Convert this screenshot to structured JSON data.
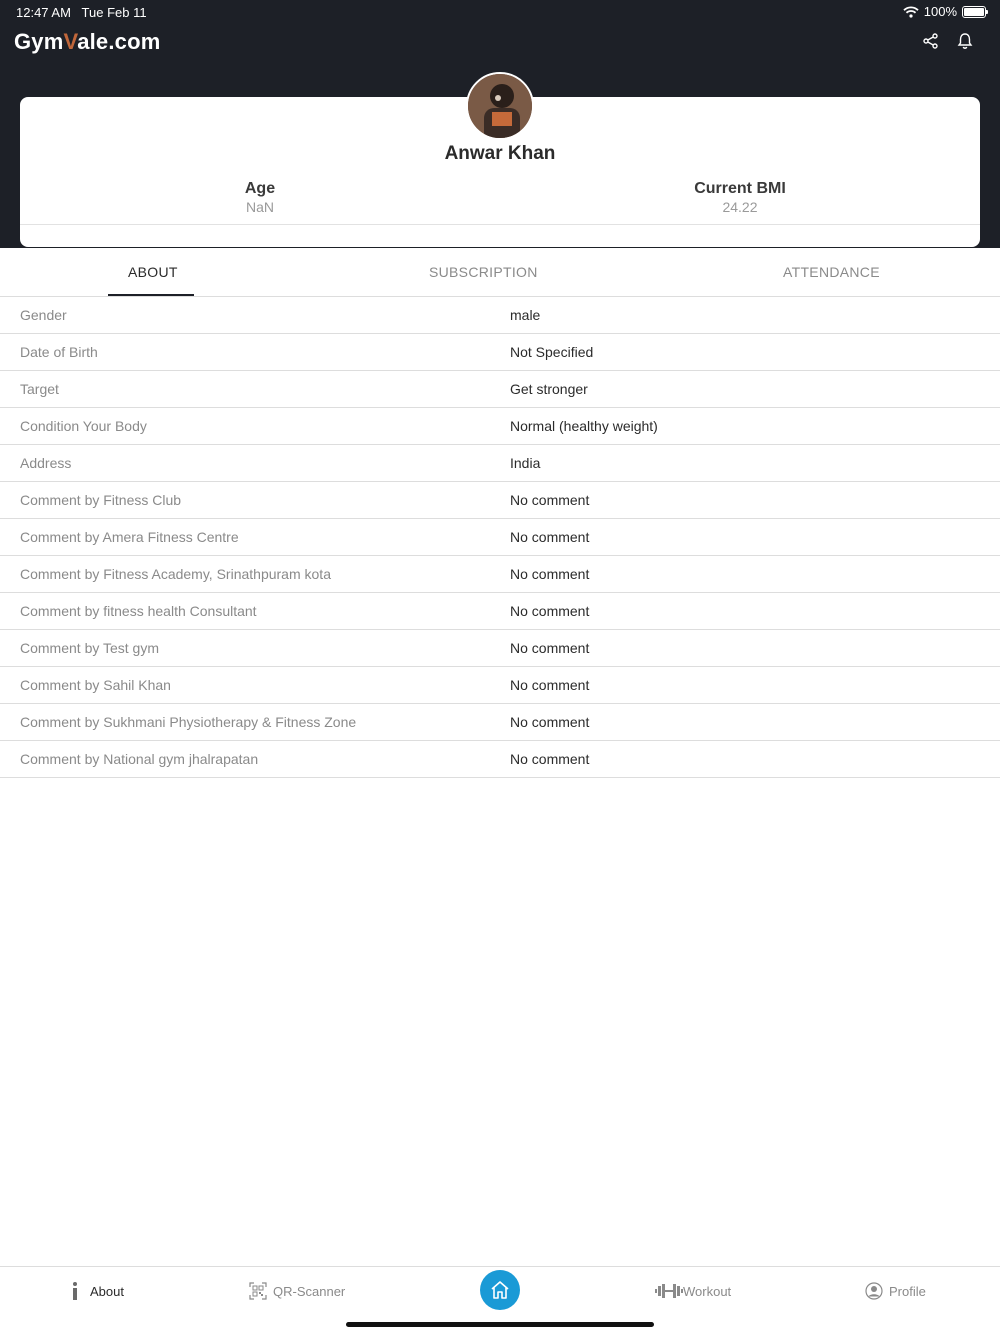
{
  "status_bar": {
    "time": "12:47 AM",
    "date": "Tue Feb 11",
    "battery": "100%"
  },
  "header": {
    "logo_prefix": "Gym",
    "logo_accent": "V",
    "logo_suffix": "ale.com",
    "icons": [
      "share-icon",
      "bell-icon"
    ]
  },
  "profile": {
    "name": "Anwar Khan",
    "age_label": "Age",
    "age_value": "NaN",
    "bmi_label": "Current BMI",
    "bmi_value": "24.22"
  },
  "tabs": {
    "about": "ABOUT",
    "subscription": "SUBSCRIPTION",
    "attendance": "ATTENDANCE",
    "active": "about"
  },
  "details": [
    {
      "label": "Gender",
      "value": "male"
    },
    {
      "label": "Date of Birth",
      "value": "Not Specified"
    },
    {
      "label": "Target",
      "value": "Get stronger"
    },
    {
      "label": "Condition Your Body",
      "value": "Normal (healthy weight)"
    },
    {
      "label": "Address",
      "value": "India"
    },
    {
      "label": "Comment by Fitness Club",
      "value": "No comment"
    },
    {
      "label": "Comment by Amera Fitness Centre",
      "value": "No comment"
    },
    {
      "label": "Comment by Fitness Academy, Srinathpuram kota",
      "value": "No comment"
    },
    {
      "label": "Comment by fitness health Consultant",
      "value": "No comment"
    },
    {
      "label": "Comment by Test gym",
      "value": "No comment"
    },
    {
      "label": "Comment by Sahil Khan",
      "value": "No comment"
    },
    {
      "label": "Comment by Sukhmani Physiotherapy & Fitness Zone",
      "value": "No comment"
    },
    {
      "label": "Comment by National gym jhalrapatan",
      "value": "No comment"
    }
  ],
  "bottom_nav": {
    "about": "About",
    "qr": "QR-Scanner",
    "workout": "Workout",
    "profile": "Profile"
  },
  "colors": {
    "header_bg": "#1d2027",
    "home_button": "#1a9ad6",
    "logo_accent": "#c0663a"
  }
}
